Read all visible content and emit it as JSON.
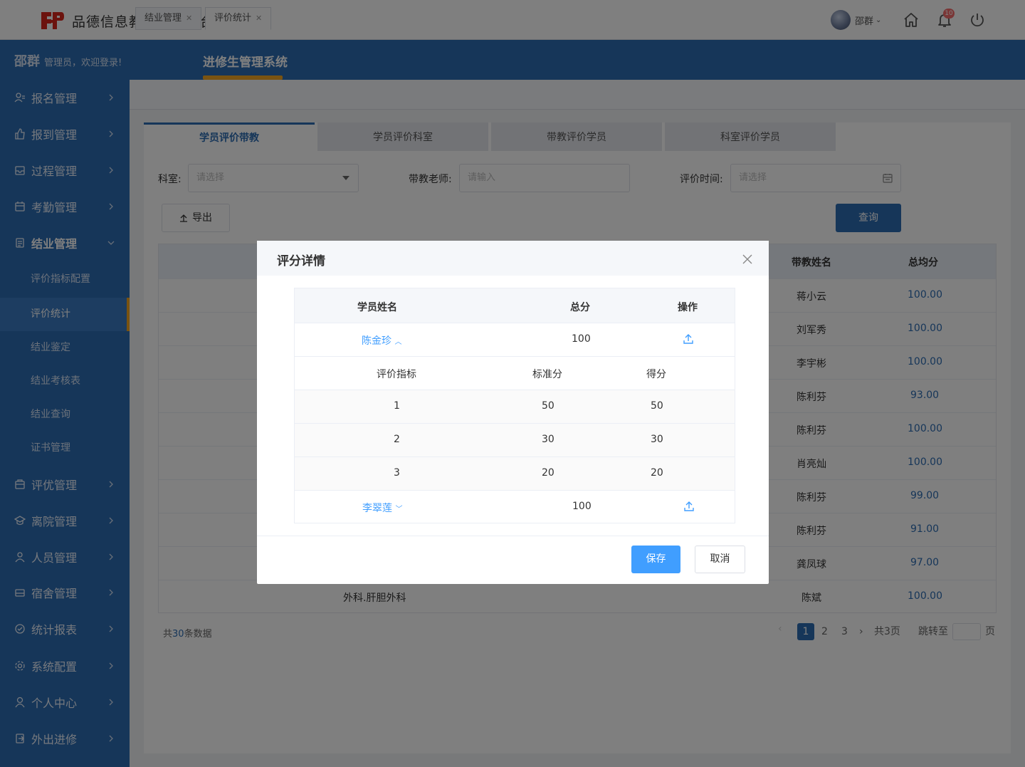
{
  "app": {
    "title": "品德信息教学管理平台"
  },
  "user": {
    "name": "邵群",
    "notification_count": "10"
  },
  "navbar": {
    "welcome_name": "邵群",
    "welcome_text": "管理员，欢迎登录!",
    "system_title": "进修生管理系统"
  },
  "sidebar": {
    "menu": [
      {
        "label": "报名管理",
        "icon": "user-list-icon"
      },
      {
        "label": "报到管理",
        "icon": "thumb-icon"
      },
      {
        "label": "过程管理",
        "icon": "tray-icon"
      },
      {
        "label": "考勤管理",
        "icon": "calendar-icon"
      },
      {
        "label": "结业管理",
        "icon": "document-icon"
      }
    ],
    "submenu": [
      {
        "label": "评价指标配置"
      },
      {
        "label": "评价统计"
      },
      {
        "label": "结业鉴定"
      },
      {
        "label": "结业考核表"
      },
      {
        "label": "结业查询"
      },
      {
        "label": "证书管理"
      }
    ],
    "menu2": [
      {
        "label": "评优管理",
        "icon": "award-icon"
      },
      {
        "label": "离院管理",
        "icon": "exit-icon"
      },
      {
        "label": "人员管理",
        "icon": "person-icon"
      },
      {
        "label": "宿舍管理",
        "icon": "bed-icon"
      },
      {
        "label": "统计报表",
        "icon": "chart-icon"
      },
      {
        "label": "系统配置",
        "icon": "settings-icon"
      },
      {
        "label": "个人中心",
        "icon": "profile-icon"
      },
      {
        "label": "外出进修",
        "icon": "outbound-icon"
      }
    ]
  },
  "page_tabs": [
    {
      "label": "结业管理"
    },
    {
      "label": "评价统计"
    }
  ],
  "sub_tabs": [
    {
      "label": "学员评价带教"
    },
    {
      "label": "学员评价科室"
    },
    {
      "label": "带教评价学员"
    },
    {
      "label": "科室评价学员"
    }
  ],
  "filters": {
    "dept_label": "科室:",
    "dept_placeholder": "请选择",
    "teacher_label": "带教老师:",
    "teacher_placeholder": "请输入",
    "time_label": "评价时间:",
    "time_placeholder": "请选择"
  },
  "buttons": {
    "export": "导出",
    "query": "查询"
  },
  "table": {
    "headers": {
      "teacher": "带教姓名",
      "avg": "总均分"
    },
    "rows": [
      {
        "teacher": "蒋小云",
        "avg": "100.00"
      },
      {
        "teacher": "刘军秀",
        "avg": "100.00"
      },
      {
        "teacher": "李宇彬",
        "avg": "100.00"
      },
      {
        "teacher": "陈利芬",
        "avg": "93.00"
      },
      {
        "teacher": "陈利芬",
        "avg": "100.00"
      },
      {
        "teacher": "肖亮灿",
        "avg": "100.00"
      },
      {
        "teacher": "陈利芬",
        "avg": "99.00"
      },
      {
        "teacher": "陈利芬",
        "avg": "91.00"
      },
      {
        "teacher": "龚凤球",
        "avg": "97.00"
      },
      {
        "dept": "外科.肝胆外科",
        "teacher": "陈斌",
        "avg": "100.00"
      }
    ]
  },
  "pagination": {
    "total_prefix": "共",
    "total_count": "30",
    "total_suffix": "条数据",
    "pages": [
      "1",
      "2",
      "3"
    ],
    "total_pages": "共3页",
    "jump_label": "跳转至",
    "page_unit": "页"
  },
  "dialog": {
    "title": "评分详情",
    "headers": {
      "student": "学员姓名",
      "total": "总分",
      "action": "操作"
    },
    "students": [
      {
        "name": "陈金珍",
        "total": "100",
        "expanded": true
      },
      {
        "name": "李翠莲",
        "total": "100",
        "expanded": false
      }
    ],
    "sub_headers": {
      "indicator": "评价指标",
      "standard": "标准分",
      "score": "得分"
    },
    "sub_rows": [
      {
        "indicator": "1",
        "standard": "50",
        "score": "50"
      },
      {
        "indicator": "2",
        "standard": "30",
        "score": "30"
      },
      {
        "indicator": "3",
        "standard": "20",
        "score": "20"
      }
    ],
    "save": "保存",
    "cancel": "取消"
  },
  "colors": {
    "primary": "#2d6cb3",
    "accent": "#f5a623",
    "link": "#409eff"
  }
}
